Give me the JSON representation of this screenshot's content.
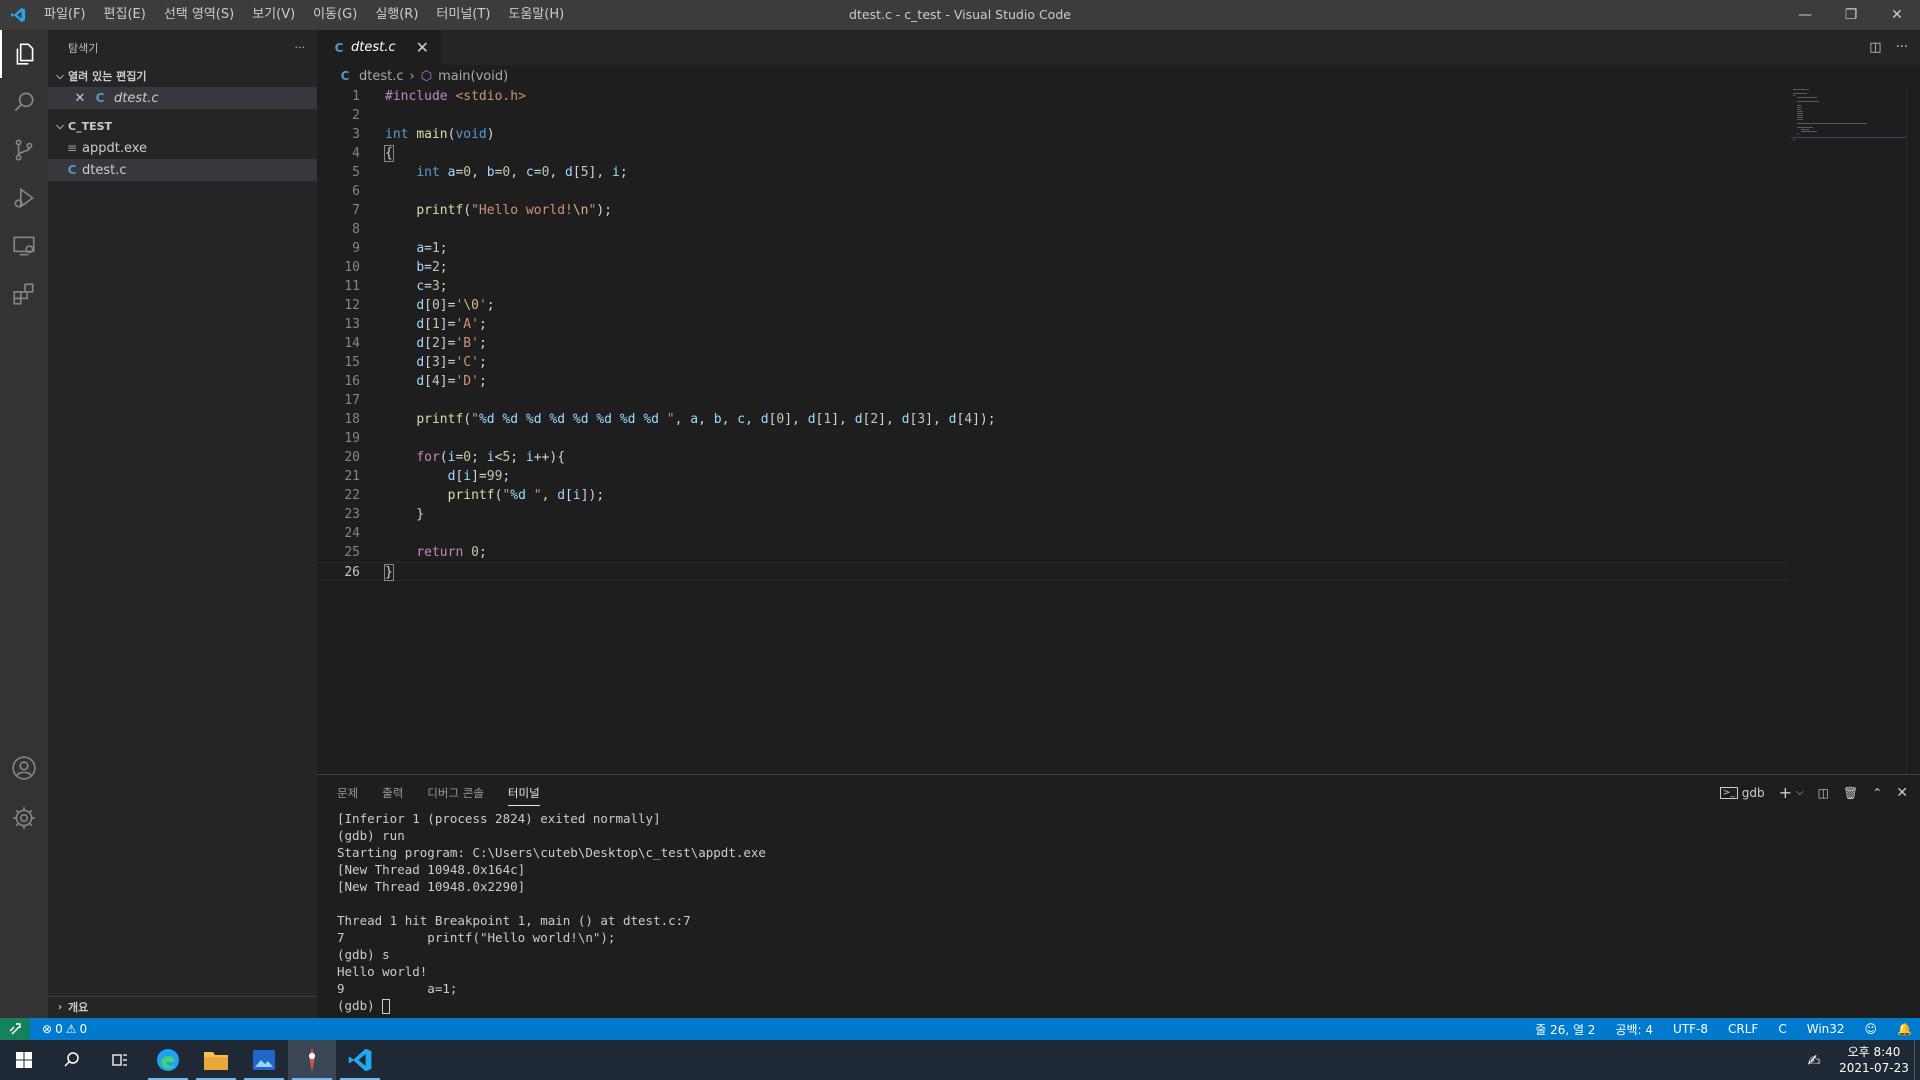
{
  "titlebar": {
    "menu": [
      "파일(F)",
      "편집(E)",
      "선택 영역(S)",
      "보기(V)",
      "이동(G)",
      "실행(R)",
      "터미널(T)",
      "도움말(H)"
    ],
    "title": "dtest.c - c_test - Visual Studio Code"
  },
  "activitybar": [
    "explorer-icon",
    "search-icon",
    "source-control-icon",
    "run-debug-icon",
    "remote-explorer-icon",
    "extensions-icon",
    "account-icon",
    "settings-gear-icon"
  ],
  "sidebar": {
    "title": "탐색기",
    "open_editors": {
      "label": "열려 있는 편집기",
      "items": [
        {
          "name": "dtest.c"
        }
      ]
    },
    "folder": {
      "label": "C_TEST",
      "items": [
        {
          "name": "appdt.exe"
        },
        {
          "name": "dtest.c"
        }
      ]
    },
    "outline_label": "개요"
  },
  "editor": {
    "tab": "dtest.c",
    "breadcrumb": {
      "file": "dtest.c",
      "symbol": "main(void)"
    },
    "lines": [
      "#include <stdio.h>",
      "",
      "int main(void)",
      "{",
      "    int a=0, b=0, c=0, d[5], i;",
      "",
      "    printf(\"Hello world!\\n\");",
      "",
      "    a=1;",
      "    b=2;",
      "    c=3;",
      "    d[0]='\\0';",
      "    d[1]='A';",
      "    d[2]='B';",
      "    d[3]='C';",
      "    d[4]='D';",
      "",
      "    printf(\"%d %d %d %d %d %d %d %d \", a, b, c, d[0], d[1], d[2], d[3], d[4]);",
      "",
      "    for(i=0; i<5; i++){",
      "        d[i]=99;",
      "        printf(\"%d \", d[i]);",
      "    }",
      "",
      "    return 0;",
      "}"
    ],
    "current_line": 26
  },
  "panel": {
    "tabs": [
      "문제",
      "출력",
      "디버그 콘솔",
      "터미널"
    ],
    "active_tab": "터미널",
    "terminal_name": "gdb",
    "terminal_lines": [
      "[Inferior 1 (process 2824) exited normally]",
      "(gdb) run",
      "Starting program: C:\\Users\\cuteb\\Desktop\\c_test\\appdt.exe",
      "[New Thread 10948.0x164c]",
      "[New Thread 10948.0x2290]",
      "",
      "Thread 1 hit Breakpoint 1, main () at dtest.c:7",
      "7           printf(\"Hello world!\\n\");",
      "(gdb) s",
      "Hello world!",
      "9           a=1;",
      "(gdb) "
    ]
  },
  "statusbar": {
    "errors": "0",
    "warnings": "0",
    "position": "줄 26, 열 2",
    "spaces": "공백: 4",
    "encoding": "UTF-8",
    "eol": "CRLF",
    "language": "C",
    "platform": "Win32"
  },
  "taskbar": {
    "time": "오후 8:40",
    "date": "2021-07-23"
  },
  "colors": {
    "accent": "#007acc",
    "remote": "#16825d"
  }
}
